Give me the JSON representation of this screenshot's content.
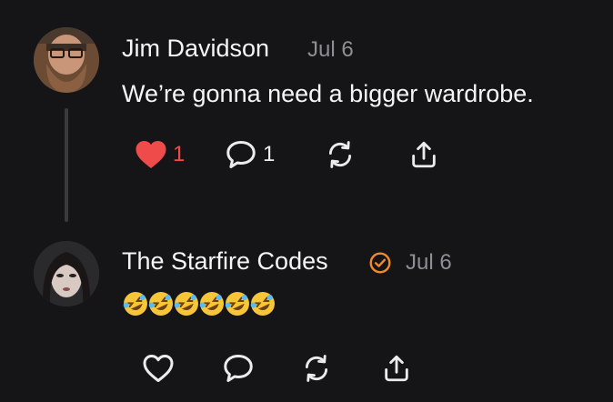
{
  "posts": [
    {
      "author": "Jim Davidson",
      "date": "Jul 6",
      "text": "We’re gonna need a bigger wardrobe.",
      "likes": "1",
      "replies": "1",
      "liked": true
    },
    {
      "author": "The Starfire Codes",
      "date": "Jul 6",
      "verified": true,
      "text": "🤣🤣🤣🤣🤣🤣",
      "liked": false
    }
  ],
  "colors": {
    "background": "#151517",
    "like_active": "#ef4b4b",
    "verified_badge": "#f18a2b",
    "muted": "#8e8e93"
  },
  "icons": [
    "heart-icon",
    "comment-icon",
    "repost-icon",
    "share-icon",
    "verified-badge-icon",
    "rofl-emoji"
  ]
}
